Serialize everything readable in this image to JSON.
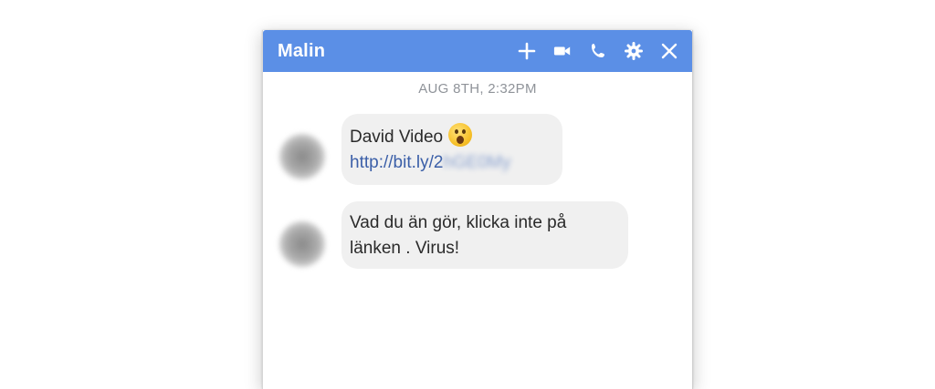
{
  "chat": {
    "contact_name": "Malin",
    "timestamp": "AUG 8TH, 2:32PM",
    "actions": [
      "add-icon",
      "video-call-icon",
      "phone-icon",
      "settings-icon",
      "close-icon"
    ]
  },
  "messages": [
    {
      "line1": "David Video",
      "emoji": "astonished-face-emoji",
      "link_visible": "http://bit.ly/2",
      "link_blurred": "hGE0My"
    },
    {
      "line1": "Vad du än gör, klicka inte på",
      "line2": "länken . Virus!"
    }
  ],
  "colors": {
    "header": "#5b8fe6",
    "bubble": "#f0f0f0",
    "link": "#3b5fa8"
  }
}
